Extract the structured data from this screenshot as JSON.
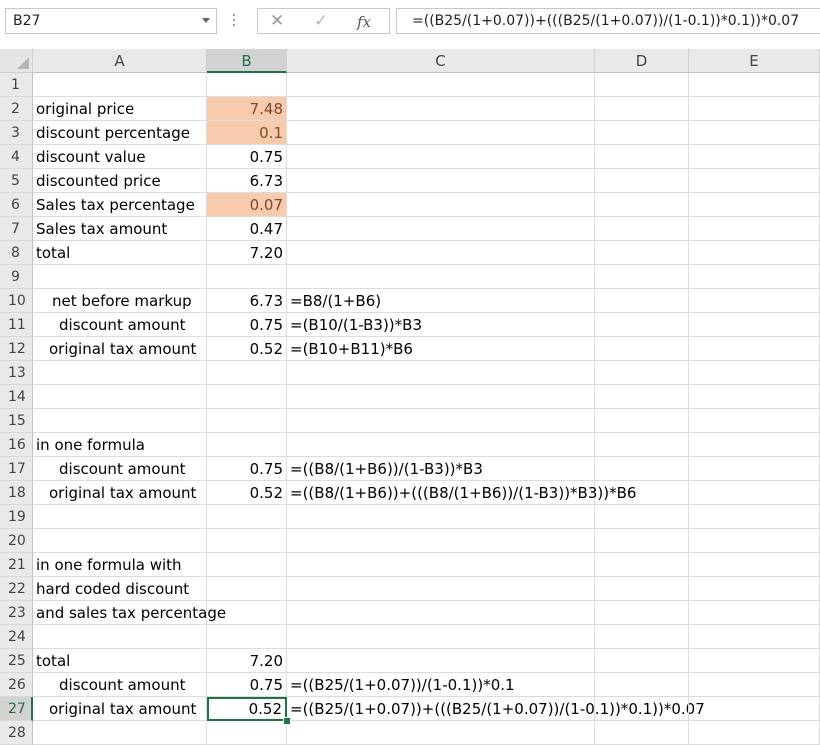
{
  "name_box": "B27",
  "formula_bar": {
    "formula": "=((B25/(1+0.07))+(((B25/(1+0.07))/(1-0.1))*0.1))*0.07"
  },
  "columns": [
    "A",
    "B",
    "C",
    "D",
    "E"
  ],
  "rows": [
    "1",
    "2",
    "3",
    "4",
    "5",
    "6",
    "7",
    "8",
    "9",
    "10",
    "11",
    "12",
    "13",
    "14",
    "15",
    "16",
    "17",
    "18",
    "19",
    "20",
    "21",
    "22",
    "23",
    "24",
    "25",
    "26",
    "27",
    "28"
  ],
  "colors": {
    "input_fill": "#f8cbad",
    "accent": "#217346"
  },
  "cells": {
    "A2": "original price",
    "B2": "7.48",
    "A3": "discount percentage",
    "B3": "0.1",
    "A4": "discount value",
    "B4": "0.75",
    "A5": "discounted price",
    "B5": "6.73",
    "A6": "Sales tax percentage",
    "B6": "0.07",
    "A7": "Sales tax amount",
    "B7": "0.47",
    "A8": "total",
    "B8": "7.20",
    "A10": "net before markup",
    "B10": "6.73",
    "C10": "=B8/(1+B6)",
    "A11": "discount amount",
    "B11": "0.75",
    "C11": "=(B10/(1-B3))*B3",
    "A12": "original tax amount",
    "B12": "0.52",
    "C12": "=(B10+B11)*B6",
    "A16": "in one formula",
    "A17": "discount amount",
    "B17": "0.75",
    "C17": "=((B8/(1+B6))/(1-B3))*B3",
    "A18": "original tax amount",
    "B18": "0.52",
    "C18": "=((B8/(1+B6))+(((B8/(1+B6))/(1-B3))*B3))*B6",
    "A21": "in one formula with",
    "A22": "hard coded discount",
    "A23": "and sales tax percentage",
    "A25": "total",
    "B25": "7.20",
    "A26": "discount amount",
    "B26": "0.75",
    "C26": "=((B25/(1+0.07))/(1-0.1))*0.1",
    "A27": "original tax amount",
    "B27": "0.52",
    "C27": "=((B25/(1+0.07))+(((B25/(1+0.07))/(1-0.1))*0.1))*0.07"
  }
}
